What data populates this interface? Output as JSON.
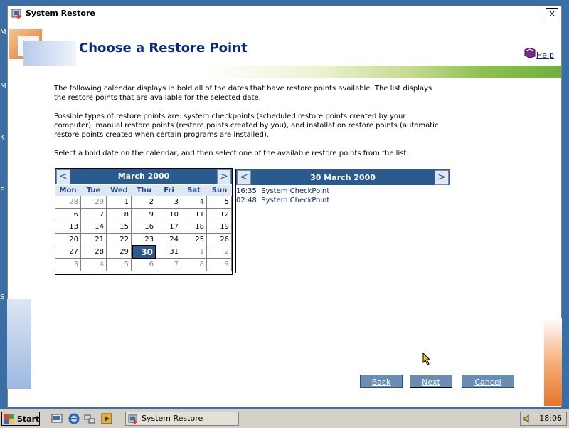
{
  "desktop": {
    "letters": [
      "M",
      "M",
      "K",
      "F",
      "S"
    ]
  },
  "window": {
    "title": "System Restore",
    "close_label": "×"
  },
  "header": {
    "title": "Choose a Restore Point",
    "help_label": "Help"
  },
  "description": [
    "The following calendar displays in bold all of the dates that have restore points available. The list displays the restore points that are available for the selected date.",
    "Possible types of restore points are: system checkpoints (scheduled restore points created by your computer), manual restore points (restore points created by you), and installation restore points (automatic restore points created when certain programs are installed).",
    "Select a bold date on the calendar, and then select one of the available restore points from the list."
  ],
  "calendar": {
    "prev_label": "<",
    "next_label": ">",
    "month": "March 2000",
    "weekdays": [
      "Mon",
      "Tue",
      "Wed",
      "Thu",
      "Fri",
      "Sat",
      "Sun"
    ],
    "selected": "30",
    "weeks": [
      [
        {
          "d": "28",
          "o": true
        },
        {
          "d": "29",
          "o": true
        },
        {
          "d": "1"
        },
        {
          "d": "2"
        },
        {
          "d": "3"
        },
        {
          "d": "4"
        },
        {
          "d": "5"
        }
      ],
      [
        {
          "d": "6"
        },
        {
          "d": "7"
        },
        {
          "d": "8"
        },
        {
          "d": "9"
        },
        {
          "d": "10"
        },
        {
          "d": "11"
        },
        {
          "d": "12"
        }
      ],
      [
        {
          "d": "13"
        },
        {
          "d": "14"
        },
        {
          "d": "15"
        },
        {
          "d": "16"
        },
        {
          "d": "17"
        },
        {
          "d": "18"
        },
        {
          "d": "19"
        }
      ],
      [
        {
          "d": "20"
        },
        {
          "d": "21"
        },
        {
          "d": "22"
        },
        {
          "d": "23"
        },
        {
          "d": "24"
        },
        {
          "d": "25"
        },
        {
          "d": "26"
        }
      ],
      [
        {
          "d": "27"
        },
        {
          "d": "28"
        },
        {
          "d": "29"
        },
        {
          "d": "30",
          "s": true
        },
        {
          "d": "31"
        },
        {
          "d": "1",
          "o": true
        },
        {
          "d": "2",
          "o": true
        }
      ],
      [
        {
          "d": "3",
          "o": true
        },
        {
          "d": "4",
          "o": true
        },
        {
          "d": "5",
          "o": true
        },
        {
          "d": "6",
          "o": true
        },
        {
          "d": "7",
          "o": true
        },
        {
          "d": "8",
          "o": true
        },
        {
          "d": "9",
          "o": true
        }
      ]
    ]
  },
  "restore_points": {
    "prev_label": "<",
    "next_label": ">",
    "date": "30 March 2000",
    "items": [
      {
        "time": "16:35",
        "label": "System CheckPoint"
      },
      {
        "time": "02:48",
        "label": "System CheckPoint"
      }
    ]
  },
  "buttons": {
    "back": "Back",
    "next": "Next",
    "cancel": "Cancel"
  },
  "taskbar": {
    "start_label": "Start",
    "task_label": "System Restore",
    "clock": "18:06"
  },
  "colors": {
    "accent": "#2b5a8e",
    "title": "#0b2a7a",
    "button": "#6a8db3"
  }
}
